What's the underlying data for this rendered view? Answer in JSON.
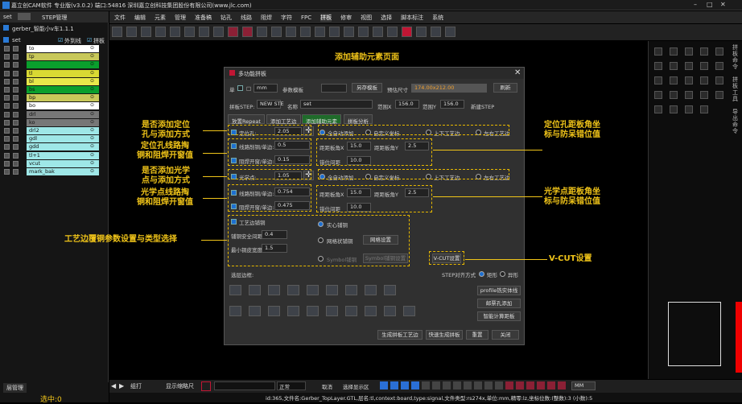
{
  "window": {
    "title": "嘉立创CAM软件 专业版(v3.0.2) 端口:54816  深圳嘉立创科技集团股份有限公司(www.jlc.com)"
  },
  "menu": [
    "文件",
    "编辑",
    "元素",
    "管理",
    "准备稿",
    "钻孔",
    "线路",
    "阻焊",
    "字符",
    "FPC",
    "拼板",
    "修审",
    "视图",
    "选择",
    "脚本标注",
    "系统"
  ],
  "left": {
    "set": "set",
    "step_label": "STEP管理",
    "job": "gerber_智能小v车1.1.1",
    "tree_root": "set",
    "outer_label": "外到线",
    "board_label": "拼板",
    "layers": [
      {
        "name": "to",
        "color": "#ffffff"
      },
      {
        "name": "tp",
        "color": "#c8c85a"
      },
      {
        "name": "",
        "color": "#0a9f2d"
      },
      {
        "name": "tl",
        "color": "#d9d933"
      },
      {
        "name": "bl",
        "color": "#e8e84a"
      },
      {
        "name": "bs",
        "color": "#0a9f2d"
      },
      {
        "name": "bp",
        "color": "#c8c85a"
      },
      {
        "name": "bo",
        "color": "#ffffff"
      },
      {
        "name": "drl",
        "color": "#777777"
      },
      {
        "name": "ko",
        "color": "#777777"
      },
      {
        "name": "drl2",
        "color": "#9ee7e7"
      },
      {
        "name": "gdl",
        "color": "#9ee7e7"
      },
      {
        "name": "gdd",
        "color": "#9ee7e7"
      },
      {
        "name": "tl+1",
        "color": "#9ee7e7"
      },
      {
        "name": "vcut",
        "color": "#9ee7e7"
      },
      {
        "name": "mark_bak",
        "color": "#9ee7e7"
      }
    ],
    "bottom_label": "层管理",
    "select_count": "选中:0"
  },
  "page_heading": "添加辅助元素页面",
  "dialog": {
    "title": "多功能拼板",
    "unit_label": "单",
    "unit": "mm",
    "param_label": "参数模板",
    "save_template": "另存模板",
    "preview_size_label": "预估尺寸",
    "preview_size": "174.00x212.00",
    "refresh": "刷新",
    "step_label": "拼板STEP:",
    "step_value": "NEW STE",
    "name_label": "名称",
    "name_value": "set",
    "range_x_label": "范围X",
    "range_x": "156.0",
    "range_y_label": "范围Y",
    "range_y": "156.0",
    "new_step": "新建STEP",
    "profile_btn": "手绘profile",
    "edit_profile": "边缘profile",
    "tabs": [
      "放置Repeat",
      "添加工艺边",
      "添加辅助元素",
      "拼板分析"
    ],
    "loc_label": "定位孔:",
    "loc_value": "2.05",
    "all_auto": "全自动添加",
    "custom_coord": "自定义坐标",
    "tb_edge": "上下工艺边",
    "lr_edge": "左右工艺边",
    "line_gap_label": "线路削铜/单边:",
    "line_gap": "0.5",
    "mask_label": "阻焊开窗/单边:",
    "mask_value": "0.15",
    "corner_x_label": "距距板角X",
    "corner_x": "15.0",
    "corner_y_label": "距距板角Y",
    "corner_y": "2.5",
    "offset_label": "错位间距",
    "offset": "10.0",
    "opt_label": "光学点:",
    "opt_value": "1.05",
    "opt_line_gap": "0.754",
    "opt_mask": "0.475",
    "opt_corner_x": "15.0",
    "opt_corner_y": "2.5",
    "opt_offset": "10.0",
    "craft_label": "工艺边铺铜",
    "craft_safe_label": "铺铜安全间距",
    "craft_safe": "0.4",
    "craft_min_label": "最小铜皮宽度",
    "craft_min": "1.5",
    "solid": "实心铺铜",
    "grid": "网格状铺铜",
    "grid_set": "网格设置",
    "symbol": "Symbol铺铜",
    "symbol_set": "Symbol铺铜设置",
    "vcut": "V-CUT设置",
    "layer_label": "选层边框:",
    "step_align_label": "STEP对齐方式",
    "rect": "矩形",
    "irregular": "异形",
    "profile_diff": "profile铣实体线",
    "board_hole": "邮票孔添加",
    "smart": "智能计算距板",
    "gen": "生成拼板工艺边",
    "quick": "快速生成拼板",
    "reset": "重置",
    "close": "关闭"
  },
  "annotations": {
    "a1": "是否添加定位\n孔与添加方式",
    "a2": "定位孔线路掏\n铜和阻焊开窗值",
    "a3": "是否添加光学\n点与添加方式",
    "a4": "光学点线路掏\n铜和阻焊开窗值",
    "a5": "工艺边覆铜参数设置与类型选择",
    "r1": "定位孔距板角坐\n标与防呆错位值",
    "r2": "光学点距板角坐\n标与防呆错位值",
    "r3": "V-CUT设置"
  },
  "bottombar": {
    "mode": "组打",
    "unit": "显示缩略尺",
    "normal": "正常",
    "sel": "取消",
    "sel2": "选择显示区",
    "mm": "MM"
  },
  "status": "id:365,文件名:Gerber_TopLayer.GTL,层名:tl,context:board,type:signal,文件类型:rs274x,单位:mm,精零:lz,坐标位数:(整数):3 (小数):5",
  "right_vertical": [
    "拼板命令",
    "拼板工具",
    "导出命令"
  ]
}
